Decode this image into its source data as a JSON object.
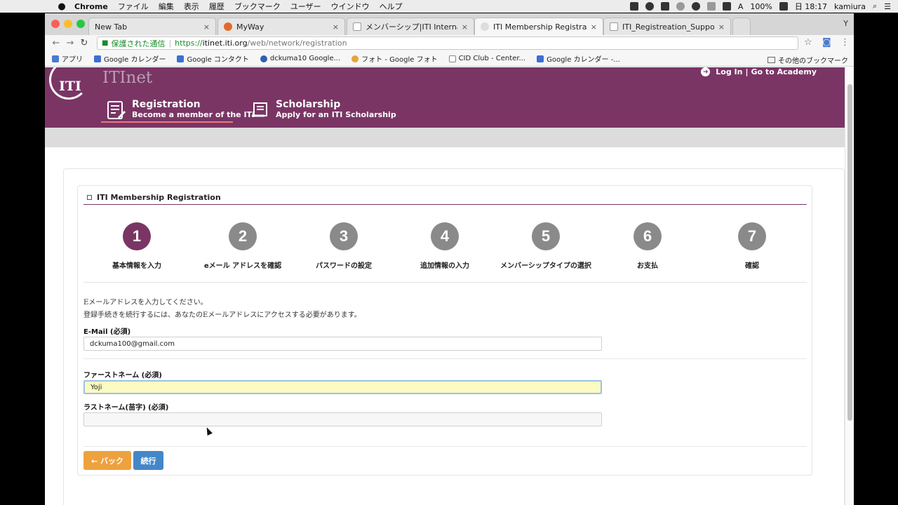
{
  "menubar": {
    "apple": "",
    "items": [
      "Chrome",
      "ファイル",
      "編集",
      "表示",
      "履歴",
      "ブックマーク",
      "ユーザー",
      "ウインドウ",
      "ヘルプ"
    ],
    "input_source": "A",
    "battery": "100%",
    "clock": "日 18:17",
    "user": "kamiura"
  },
  "tabs": [
    {
      "title": "New Tab",
      "close": "×"
    },
    {
      "title": "MyWay",
      "close": "×"
    },
    {
      "title": "メンバーシップ|ITI International",
      "close": "×"
    },
    {
      "title": "ITI Membership Registration",
      "close": "×"
    },
    {
      "title": "ITI_Registreation_Support_For",
      "close": "×"
    }
  ],
  "profile_letter": "Y",
  "omnibox": {
    "secure_label": "保護された通信",
    "scheme": "https://",
    "host": "itinet.iti.org",
    "path": "/web/network/registration"
  },
  "bookmarks": [
    {
      "label": "アプリ",
      "color": "#4a7bd0"
    },
    {
      "label": "Google カレンダー",
      "color": "#3b6fd4"
    },
    {
      "label": "Google コンタクト",
      "color": "#3b6fd4"
    },
    {
      "label": "dckuma10 Google...",
      "color": "#2f5fb0"
    },
    {
      "label": "フォト - Google フォト",
      "color": "#e8a33a"
    },
    {
      "label": "CID Club - Center...",
      "color": "#888888"
    },
    {
      "label": "Google カレンダー -...",
      "color": "#3b6fd4"
    }
  ],
  "bookmarks_other": "その他のブックマーク",
  "site": {
    "logo": "ITI",
    "brand": "ITInet",
    "login": "Log In",
    "divider": "|",
    "academy": "Go to Academy",
    "nav": [
      {
        "title": "Registration",
        "subtitle": "Become a member of the ITI"
      },
      {
        "title": "Scholarship",
        "subtitle": "Apply for an ITI Scholarship"
      }
    ]
  },
  "panel": {
    "title": "ITI Membership Registration"
  },
  "steps": [
    {
      "number": "1",
      "label": "基本情報を入力"
    },
    {
      "number": "2",
      "label": "eメール アドレスを確認"
    },
    {
      "number": "3",
      "label": "パスワードの設定"
    },
    {
      "number": "4",
      "label": "追加情報の入力"
    },
    {
      "number": "5",
      "label": "メンバーシップタイプの選択"
    },
    {
      "number": "6",
      "label": "お支払"
    },
    {
      "number": "7",
      "label": "確認"
    }
  ],
  "active_step": 1,
  "form": {
    "instruction_1": "Eメールアドレスを入力してください。",
    "instruction_2": "登録手続きを続行するには、あなたのEメールアドレスにアクセスする必要があります。",
    "email_label": "E-Mail (必須)",
    "email_value": "dckuma100@gmail.com",
    "first_name_label": "ファーストネーム (必須)",
    "first_name_value": "Yoji",
    "last_name_label": "ラストネーム(苗字) (必須)",
    "last_name_value": ""
  },
  "buttons": {
    "back": "← バック",
    "continue": "続行"
  },
  "colors": {
    "brand_purple": "#7a3565",
    "step_inactive": "#8a8a8a",
    "back_button": "#eea23e",
    "continue_button": "#4487c8",
    "autofill": "#fbfbc2"
  }
}
